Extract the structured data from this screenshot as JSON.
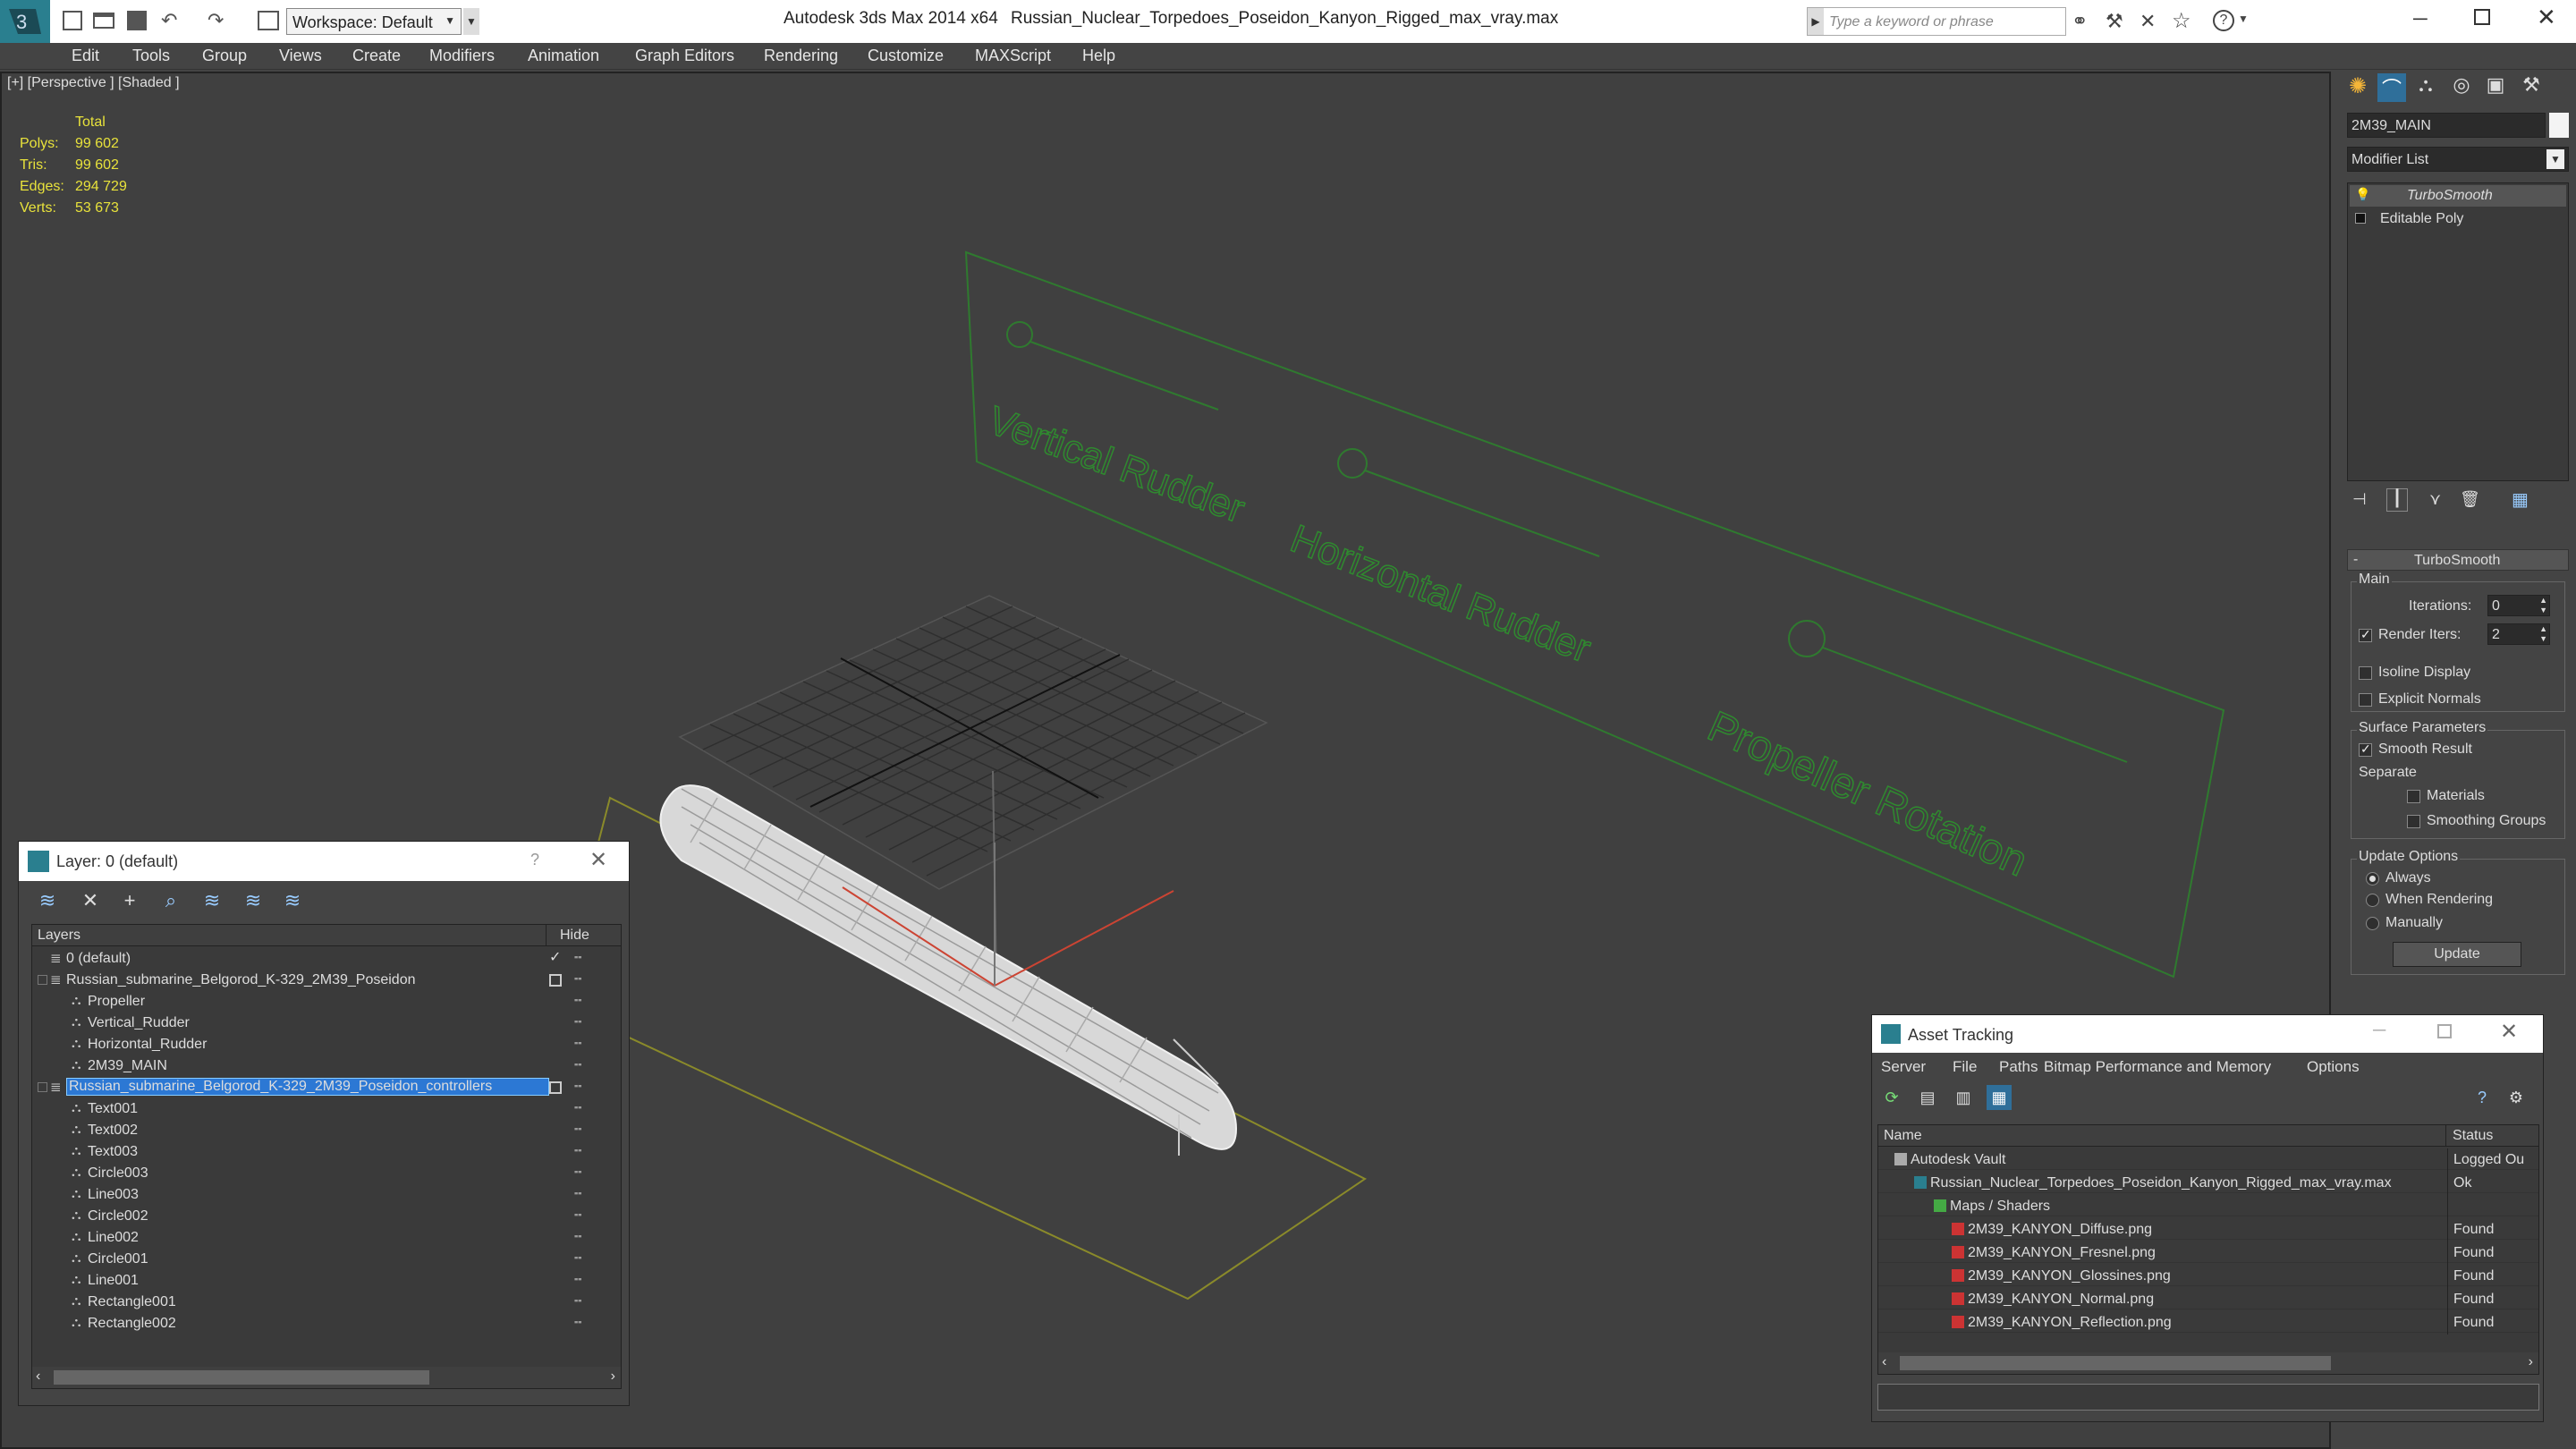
{
  "titlebar": {
    "app": "Autodesk 3ds Max  2014 x64",
    "file": "Russian_Nuclear_Torpedoes_Poseidon_Kanyon_Rigged_max_vray.max",
    "workspace": "Workspace: Default",
    "search_placeholder": "Type a keyword or phrase"
  },
  "menu": [
    "Edit",
    "Tools",
    "Group",
    "Views",
    "Create",
    "Modifiers",
    "Animation",
    "Graph Editors",
    "Rendering",
    "Customize",
    "MAXScript",
    "Help"
  ],
  "viewport": {
    "label": "[+] [Perspective ] [Shaded ]",
    "stats": {
      "header": "Total",
      "rows": [
        {
          "label": "Polys:",
          "value": "99 602"
        },
        {
          "label": "Tris:",
          "value": "99 602"
        },
        {
          "label": "Edges:",
          "value": "294 729"
        },
        {
          "label": "Verts:",
          "value": "53 673"
        }
      ]
    },
    "controller_labels": [
      "Vertical Rudder",
      "Horizontal Rudder",
      "Propeller Rotation"
    ]
  },
  "command_panel": {
    "object_name": "2M39_MAIN",
    "modifier_list": "Modifier List",
    "stack": [
      "TurboSmooth",
      "Editable Poly"
    ],
    "rollout_title": "TurboSmooth",
    "main_group": "Main",
    "iterations_label": "Iterations:",
    "iterations_value": "0",
    "render_iters_label": "Render Iters:",
    "render_iters_value": "2",
    "isoline": "Isoline Display",
    "explicit": "Explicit Normals",
    "surface_group": "Surface Parameters",
    "smooth_result": "Smooth Result",
    "separate": "Separate",
    "materials": "Materials",
    "smoothing_groups": "Smoothing Groups",
    "update_group": "Update Options",
    "always": "Always",
    "when_rendering": "When Rendering",
    "manually": "Manually",
    "update_button": "Update"
  },
  "layer_window": {
    "title": "Layer: 0 (default)",
    "col_layers": "Layers",
    "col_hide": "Hide",
    "rows": [
      {
        "name": "0 (default)",
        "level": 0
      },
      {
        "name": "Russian_submarine_Belgorod_K-329_2M39_Poseidon",
        "level": 0
      },
      {
        "name": "Propeller",
        "level": 1
      },
      {
        "name": "Vertical_Rudder",
        "level": 1
      },
      {
        "name": "Horizontal_Rudder",
        "level": 1
      },
      {
        "name": "2M39_MAIN",
        "level": 1
      },
      {
        "name": "Russian_submarine_Belgorod_K-329_2M39_Poseidon_controllers",
        "level": 0,
        "selected": true
      },
      {
        "name": "Text001",
        "level": 1
      },
      {
        "name": "Text002",
        "level": 1
      },
      {
        "name": "Text003",
        "level": 1
      },
      {
        "name": "Circle003",
        "level": 1
      },
      {
        "name": "Line003",
        "level": 1
      },
      {
        "name": "Circle002",
        "level": 1
      },
      {
        "name": "Line002",
        "level": 1
      },
      {
        "name": "Circle001",
        "level": 1
      },
      {
        "name": "Line001",
        "level": 1
      },
      {
        "name": "Rectangle001",
        "level": 1
      },
      {
        "name": "Rectangle002",
        "level": 1
      }
    ]
  },
  "asset_window": {
    "title": "Asset Tracking",
    "menu": [
      "Server",
      "File",
      "Paths",
      "Bitmap Performance and Memory",
      "Options"
    ],
    "col_name": "Name",
    "col_status": "Status",
    "rows": [
      {
        "name": "Autodesk Vault",
        "status": "Logged Ou",
        "level": 0
      },
      {
        "name": "Russian_Nuclear_Torpedoes_Poseidon_Kanyon_Rigged_max_vray.max",
        "status": "Ok",
        "level": 1
      },
      {
        "name": "Maps / Shaders",
        "status": "",
        "level": 2
      },
      {
        "name": "2M39_KANYON_Diffuse.png",
        "status": "Found",
        "level": 3
      },
      {
        "name": "2M39_KANYON_Fresnel.png",
        "status": "Found",
        "level": 3
      },
      {
        "name": "2M39_KANYON_Glossines.png",
        "status": "Found",
        "level": 3
      },
      {
        "name": "2M39_KANYON_Normal.png",
        "status": "Found",
        "level": 3
      },
      {
        "name": "2M39_KANYON_Reflection.png",
        "status": "Found",
        "level": 3
      }
    ]
  }
}
